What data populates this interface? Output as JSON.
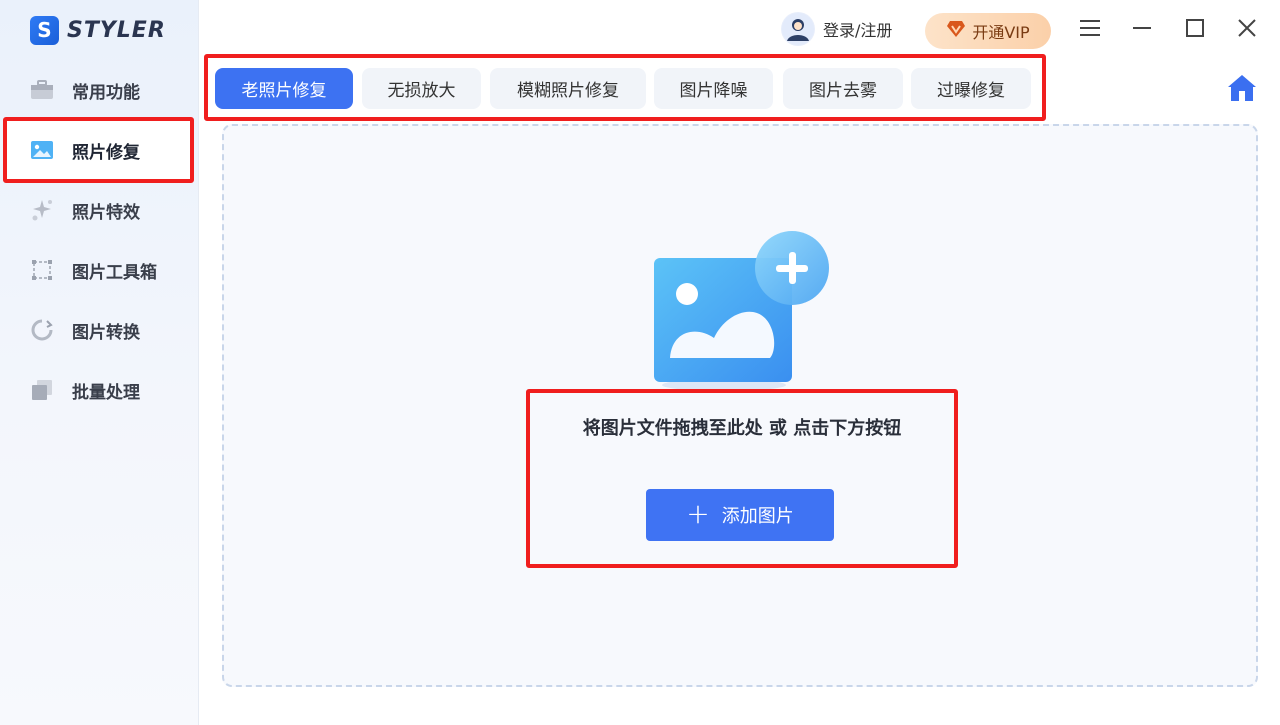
{
  "app": {
    "logo_letter": "S",
    "name": "STYLER"
  },
  "sidebar": {
    "items": [
      {
        "label": "常用功能",
        "icon": "toolbox-icon",
        "active": false
      },
      {
        "label": "照片修复",
        "icon": "photo-icon",
        "active": true
      },
      {
        "label": "照片特效",
        "icon": "sparkle-icon",
        "active": false
      },
      {
        "label": "图片工具箱",
        "icon": "crop-frame-icon",
        "active": false
      },
      {
        "label": "图片转换",
        "icon": "convert-icon",
        "active": false
      },
      {
        "label": "批量处理",
        "icon": "batch-icon",
        "active": false
      }
    ]
  },
  "header": {
    "user_label": "登录/注册",
    "vip_label": "开通VIP"
  },
  "tabs": [
    {
      "label": "老照片修复",
      "active": true
    },
    {
      "label": "无损放大",
      "active": false
    },
    {
      "label": "模糊照片修复",
      "active": false
    },
    {
      "label": "图片降噪",
      "active": false
    },
    {
      "label": "图片去雾",
      "active": false
    },
    {
      "label": "过曝修复",
      "active": false
    }
  ],
  "dropzone": {
    "hint": "将图片文件拖拽至此处 或 点击下方按钮",
    "add_button": "添加图片"
  },
  "colors": {
    "accent": "#3d72f2",
    "highlight": "#f01e1e",
    "vip_bg": "#fbd0a9"
  }
}
